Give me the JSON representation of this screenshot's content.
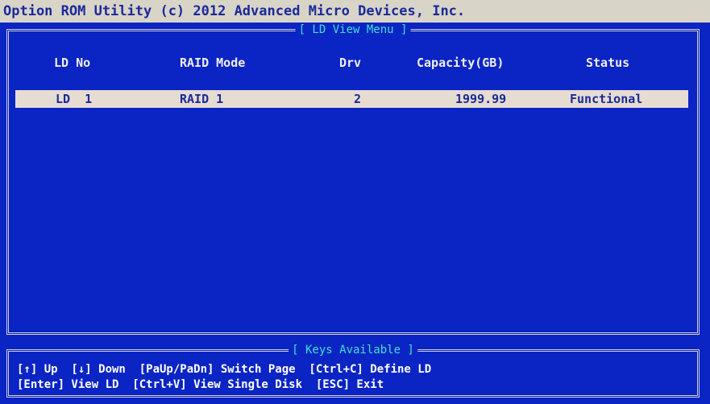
{
  "title": "Option ROM Utility (c) 2012 Advanced Micro Devices, Inc.",
  "menu_title": "[ LD View Menu ]",
  "table": {
    "headers": {
      "ld_no": "LD No",
      "raid_mode": "RAID Mode",
      "drv": "Drv",
      "capacity": "Capacity(GB)",
      "status": "Status"
    },
    "rows": [
      {
        "ld_no": "LD  1",
        "raid_mode": "RAID 1",
        "drv": "2",
        "capacity": "1999.99",
        "status": "Functional"
      }
    ]
  },
  "keys": {
    "title": "[ Keys Available ]",
    "line1": "[↑] Up  [↓] Down  [PaUp/PaDn] Switch Page  [Ctrl+C] Define LD",
    "line2": "[Enter] View LD  [Ctrl+V] View Single Disk  [ESC] Exit"
  },
  "colors": {
    "background": "#0b24c4",
    "title_bar": "#d9d4c8",
    "selected_row": "#e6dcd2",
    "frame_title": "#3fe0d0"
  }
}
